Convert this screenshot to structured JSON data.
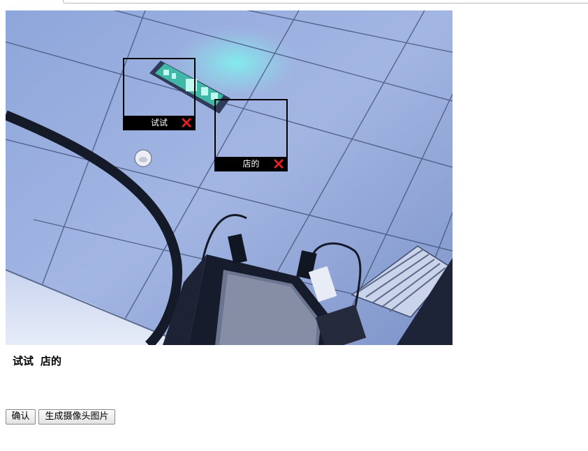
{
  "camera": {
    "scene_description_icon": "webcam-feed-image",
    "exit_sign_icon": "exit-sign-icon",
    "tags": [
      {
        "label": "试试",
        "close_icon": "close-icon"
      },
      {
        "label": "店的",
        "close_icon": "close-icon"
      }
    ]
  },
  "names": [
    "试试",
    "店的"
  ],
  "buttons": {
    "confirm_label": "确认",
    "generate_label": "生成摄像头图片"
  },
  "colors": {
    "ceiling": "#8fa6d8",
    "tag_bar": "#000000",
    "close_red": "#e02020"
  }
}
